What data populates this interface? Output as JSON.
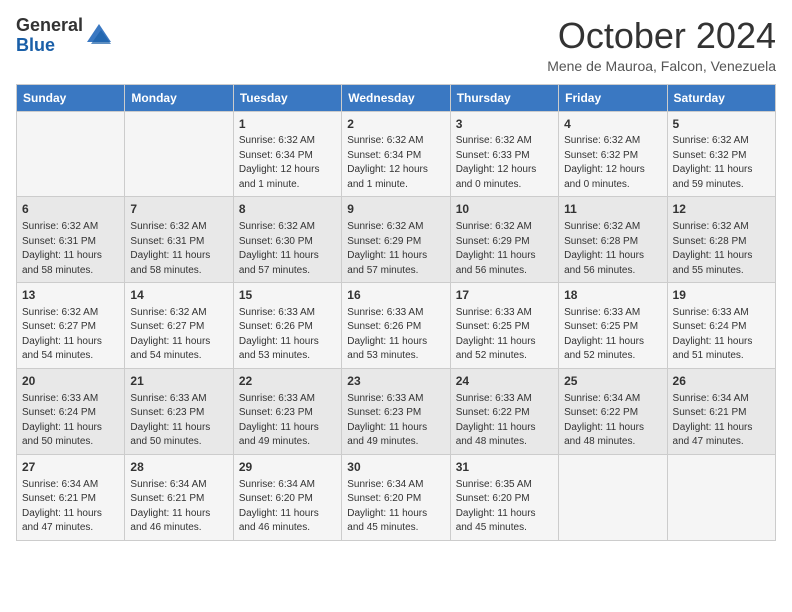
{
  "header": {
    "logo_general": "General",
    "logo_blue": "Blue",
    "month_title": "October 2024",
    "subtitle": "Mene de Mauroa, Falcon, Venezuela"
  },
  "weekdays": [
    "Sunday",
    "Monday",
    "Tuesday",
    "Wednesday",
    "Thursday",
    "Friday",
    "Saturday"
  ],
  "weeks": [
    [
      {
        "day": "",
        "sunrise": "",
        "sunset": "",
        "daylight": ""
      },
      {
        "day": "",
        "sunrise": "",
        "sunset": "",
        "daylight": ""
      },
      {
        "day": "1",
        "sunrise": "Sunrise: 6:32 AM",
        "sunset": "Sunset: 6:34 PM",
        "daylight": "Daylight: 12 hours and 1 minute."
      },
      {
        "day": "2",
        "sunrise": "Sunrise: 6:32 AM",
        "sunset": "Sunset: 6:34 PM",
        "daylight": "Daylight: 12 hours and 1 minute."
      },
      {
        "day": "3",
        "sunrise": "Sunrise: 6:32 AM",
        "sunset": "Sunset: 6:33 PM",
        "daylight": "Daylight: 12 hours and 0 minutes."
      },
      {
        "day": "4",
        "sunrise": "Sunrise: 6:32 AM",
        "sunset": "Sunset: 6:32 PM",
        "daylight": "Daylight: 12 hours and 0 minutes."
      },
      {
        "day": "5",
        "sunrise": "Sunrise: 6:32 AM",
        "sunset": "Sunset: 6:32 PM",
        "daylight": "Daylight: 11 hours and 59 minutes."
      }
    ],
    [
      {
        "day": "6",
        "sunrise": "Sunrise: 6:32 AM",
        "sunset": "Sunset: 6:31 PM",
        "daylight": "Daylight: 11 hours and 58 minutes."
      },
      {
        "day": "7",
        "sunrise": "Sunrise: 6:32 AM",
        "sunset": "Sunset: 6:31 PM",
        "daylight": "Daylight: 11 hours and 58 minutes."
      },
      {
        "day": "8",
        "sunrise": "Sunrise: 6:32 AM",
        "sunset": "Sunset: 6:30 PM",
        "daylight": "Daylight: 11 hours and 57 minutes."
      },
      {
        "day": "9",
        "sunrise": "Sunrise: 6:32 AM",
        "sunset": "Sunset: 6:29 PM",
        "daylight": "Daylight: 11 hours and 57 minutes."
      },
      {
        "day": "10",
        "sunrise": "Sunrise: 6:32 AM",
        "sunset": "Sunset: 6:29 PM",
        "daylight": "Daylight: 11 hours and 56 minutes."
      },
      {
        "day": "11",
        "sunrise": "Sunrise: 6:32 AM",
        "sunset": "Sunset: 6:28 PM",
        "daylight": "Daylight: 11 hours and 56 minutes."
      },
      {
        "day": "12",
        "sunrise": "Sunrise: 6:32 AM",
        "sunset": "Sunset: 6:28 PM",
        "daylight": "Daylight: 11 hours and 55 minutes."
      }
    ],
    [
      {
        "day": "13",
        "sunrise": "Sunrise: 6:32 AM",
        "sunset": "Sunset: 6:27 PM",
        "daylight": "Daylight: 11 hours and 54 minutes."
      },
      {
        "day": "14",
        "sunrise": "Sunrise: 6:32 AM",
        "sunset": "Sunset: 6:27 PM",
        "daylight": "Daylight: 11 hours and 54 minutes."
      },
      {
        "day": "15",
        "sunrise": "Sunrise: 6:33 AM",
        "sunset": "Sunset: 6:26 PM",
        "daylight": "Daylight: 11 hours and 53 minutes."
      },
      {
        "day": "16",
        "sunrise": "Sunrise: 6:33 AM",
        "sunset": "Sunset: 6:26 PM",
        "daylight": "Daylight: 11 hours and 53 minutes."
      },
      {
        "day": "17",
        "sunrise": "Sunrise: 6:33 AM",
        "sunset": "Sunset: 6:25 PM",
        "daylight": "Daylight: 11 hours and 52 minutes."
      },
      {
        "day": "18",
        "sunrise": "Sunrise: 6:33 AM",
        "sunset": "Sunset: 6:25 PM",
        "daylight": "Daylight: 11 hours and 52 minutes."
      },
      {
        "day": "19",
        "sunrise": "Sunrise: 6:33 AM",
        "sunset": "Sunset: 6:24 PM",
        "daylight": "Daylight: 11 hours and 51 minutes."
      }
    ],
    [
      {
        "day": "20",
        "sunrise": "Sunrise: 6:33 AM",
        "sunset": "Sunset: 6:24 PM",
        "daylight": "Daylight: 11 hours and 50 minutes."
      },
      {
        "day": "21",
        "sunrise": "Sunrise: 6:33 AM",
        "sunset": "Sunset: 6:23 PM",
        "daylight": "Daylight: 11 hours and 50 minutes."
      },
      {
        "day": "22",
        "sunrise": "Sunrise: 6:33 AM",
        "sunset": "Sunset: 6:23 PM",
        "daylight": "Daylight: 11 hours and 49 minutes."
      },
      {
        "day": "23",
        "sunrise": "Sunrise: 6:33 AM",
        "sunset": "Sunset: 6:23 PM",
        "daylight": "Daylight: 11 hours and 49 minutes."
      },
      {
        "day": "24",
        "sunrise": "Sunrise: 6:33 AM",
        "sunset": "Sunset: 6:22 PM",
        "daylight": "Daylight: 11 hours and 48 minutes."
      },
      {
        "day": "25",
        "sunrise": "Sunrise: 6:34 AM",
        "sunset": "Sunset: 6:22 PM",
        "daylight": "Daylight: 11 hours and 48 minutes."
      },
      {
        "day": "26",
        "sunrise": "Sunrise: 6:34 AM",
        "sunset": "Sunset: 6:21 PM",
        "daylight": "Daylight: 11 hours and 47 minutes."
      }
    ],
    [
      {
        "day": "27",
        "sunrise": "Sunrise: 6:34 AM",
        "sunset": "Sunset: 6:21 PM",
        "daylight": "Daylight: 11 hours and 47 minutes."
      },
      {
        "day": "28",
        "sunrise": "Sunrise: 6:34 AM",
        "sunset": "Sunset: 6:21 PM",
        "daylight": "Daylight: 11 hours and 46 minutes."
      },
      {
        "day": "29",
        "sunrise": "Sunrise: 6:34 AM",
        "sunset": "Sunset: 6:20 PM",
        "daylight": "Daylight: 11 hours and 46 minutes."
      },
      {
        "day": "30",
        "sunrise": "Sunrise: 6:34 AM",
        "sunset": "Sunset: 6:20 PM",
        "daylight": "Daylight: 11 hours and 45 minutes."
      },
      {
        "day": "31",
        "sunrise": "Sunrise: 6:35 AM",
        "sunset": "Sunset: 6:20 PM",
        "daylight": "Daylight: 11 hours and 45 minutes."
      },
      {
        "day": "",
        "sunrise": "",
        "sunset": "",
        "daylight": ""
      },
      {
        "day": "",
        "sunrise": "",
        "sunset": "",
        "daylight": ""
      }
    ]
  ]
}
